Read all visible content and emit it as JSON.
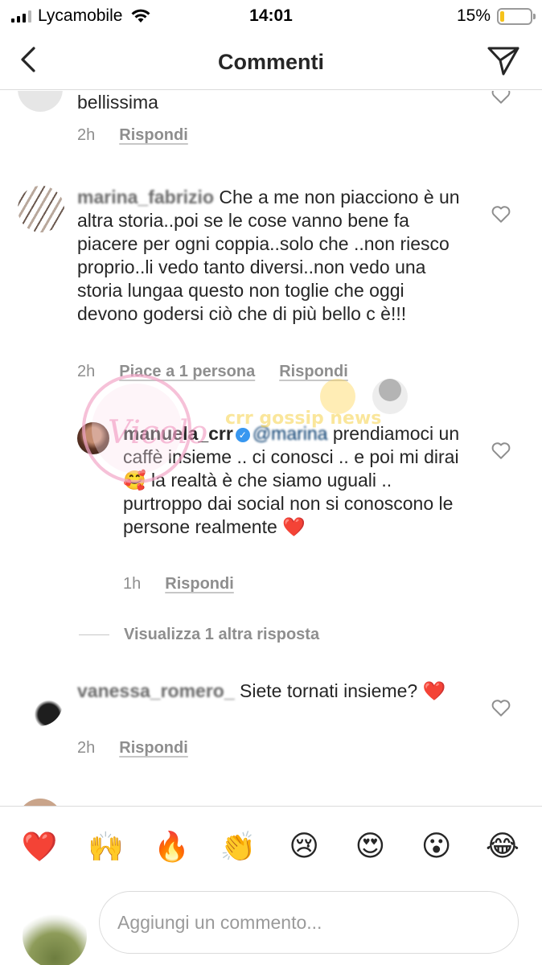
{
  "status_bar": {
    "carrier": "Lycamobile",
    "time": "14:01",
    "battery_percent_text": "15%",
    "battery_level": 0.15,
    "battery_color": "#f5c21b"
  },
  "header": {
    "title": "Commenti",
    "back_icon": "chevron-left-icon",
    "send_icon": "paper-plane-icon"
  },
  "comments": [
    {
      "user": "",
      "text": "bellissima",
      "time": "2h",
      "likes": "",
      "reply": "Rispondi"
    },
    {
      "user": "",
      "text": "Che a me non piacciono è un altra storia..poi se le cose vanno bene fa piacere per ogni coppia..solo che ..non riesco proprio..li vedo tanto diversi..non vedo una storia lungaa questo non toglie che oggi devono godersi ciò che di più bello c è!!!",
      "time": "2h",
      "likes": "Piace a 1 persona",
      "reply": "Rispondi"
    },
    {
      "user": "manuela_crr",
      "mention": "@marina",
      "text": "prendiamoci un caffè insieme .. ci conosci .. e poi mi dirai 🥰 la realtà è che siamo uguali .. purtroppo dai social non si conoscono le persone realmente ❤️",
      "time": "1h",
      "likes": "",
      "reply": "Rispondi"
    },
    {
      "user": "",
      "text": "Siete tornati insieme? ❤️",
      "time": "2h",
      "likes": "",
      "reply": "Rispondi"
    }
  ],
  "view_more_replies": "Visualizza 1 altra risposta",
  "emoji_bar": [
    "❤️",
    "🙌",
    "🔥",
    "👏",
    "😢",
    "😍",
    "😮",
    "😂"
  ],
  "composer": {
    "placeholder": "Aggiungi un commento..."
  },
  "colors": {
    "text": "#262626",
    "secondary": "#8e8e8e",
    "divider": "#dbdbdb",
    "verified": "#3897f0"
  }
}
